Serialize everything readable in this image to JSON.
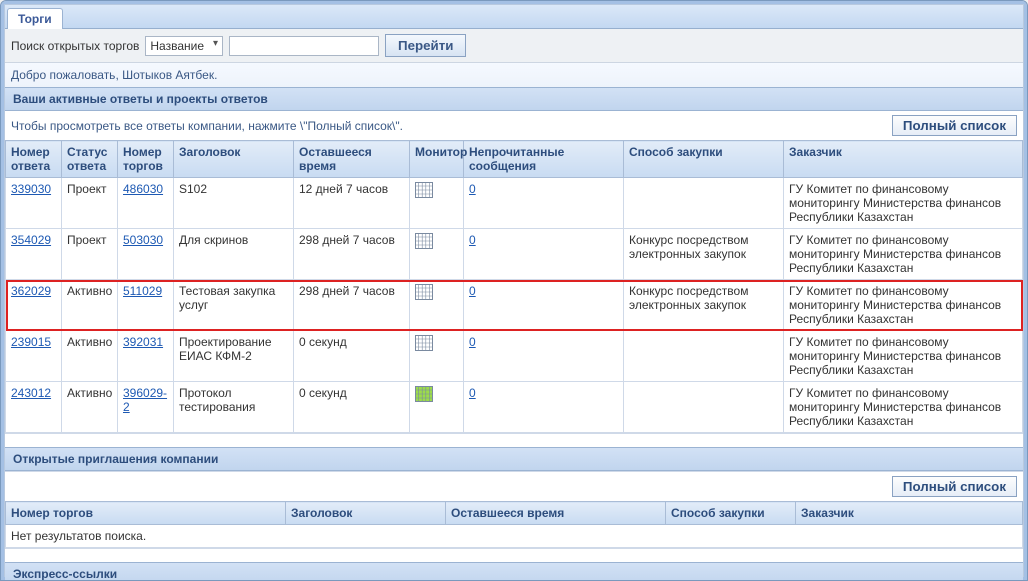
{
  "tab": {
    "label": "Торги"
  },
  "search": {
    "label": "Поиск открытых торгов",
    "select_value": "Название",
    "input_value": "",
    "go_label": "Перейти"
  },
  "welcome": "Добро пожаловать, Шотыков Аятбек.",
  "responses": {
    "title": "Ваши активные ответы и проекты ответов",
    "hint": "Чтобы просмотреть все ответы компании, нажмите \\\"Полный список\\\".",
    "full_list_label": "Полный список",
    "columns": {
      "resp_num": "Номер ответа",
      "resp_status": "Статус ответа",
      "bid_num": "Номер торгов",
      "title": "Заголовок",
      "remaining": "Оставшееся время",
      "monitor": "Монитор",
      "unread": "Непрочитанные сообщения",
      "method": "Способ закупки",
      "customer": "Заказчик"
    },
    "rows": [
      {
        "resp_num": "339030",
        "resp_status": "Проект",
        "bid_num": "486030",
        "title": "S102",
        "remaining": "12 дней 7 часов",
        "monitor": "grid",
        "unread": "0",
        "method": "",
        "customer": "ГУ Комитет по финансовому мониторингу Министерства финансов Республики Казахстан",
        "highlight": false
      },
      {
        "resp_num": "354029",
        "resp_status": "Проект",
        "bid_num": "503030",
        "title": "Для скринов",
        "remaining": "298 дней 7 часов",
        "monitor": "grid",
        "unread": "0",
        "method": "Конкурс посредством электронных закупок",
        "customer": "ГУ Комитет по финансовому мониторингу Министерства финансов Республики Казахстан",
        "highlight": false
      },
      {
        "resp_num": "362029",
        "resp_status": "Активно",
        "bid_num": "511029",
        "title": "Тестовая закупка услуг",
        "remaining": "298 дней 7 часов",
        "monitor": "grid",
        "unread": "0",
        "method": "Конкурс посредством электронных закупок",
        "customer": "ГУ Комитет по финансовому мониторингу Министерства финансов Республики Казахстан",
        "highlight": true
      },
      {
        "resp_num": "239015",
        "resp_status": "Активно",
        "bid_num": "392031",
        "title": "Проектирование ЕИАС КФМ-2",
        "remaining": "0 секунд",
        "monitor": "grid",
        "unread": "0",
        "method": "",
        "customer": "ГУ Комитет по финансовому мониторингу Министерства финансов Республики Казахстан",
        "highlight": false
      },
      {
        "resp_num": "243012",
        "resp_status": "Активно",
        "bid_num": "396029-2",
        "title": "Протокол тестирования",
        "remaining": "0 секунд",
        "monitor": "grid-green",
        "unread": "0",
        "method": "",
        "customer": "ГУ Комитет по финансовому мониторингу Министерства финансов Республики Казахстан",
        "highlight": false
      }
    ]
  },
  "invites": {
    "title": "Открытые приглашения компании",
    "full_list_label": "Полный список",
    "columns": {
      "bid_num": "Номер торгов",
      "title": "Заголовок",
      "remaining": "Оставшееся время",
      "method": "Способ закупки",
      "customer": "Заказчик"
    },
    "no_results": "Нет результатов поиска."
  },
  "quicklinks": {
    "title": "Экспресс-ссылки"
  }
}
